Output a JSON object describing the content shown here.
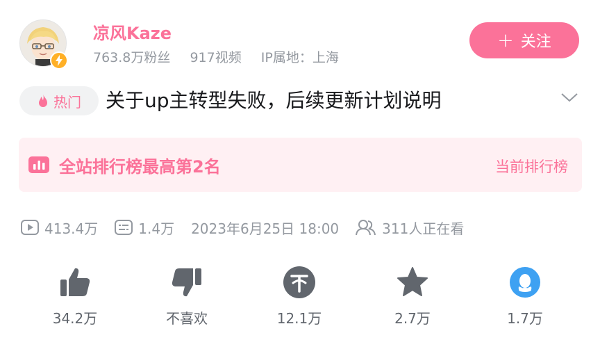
{
  "author": {
    "name": "凉风Kaze",
    "followers": "763.8万粉丝",
    "videos": "917视频",
    "ip_location": "IP属地：上海",
    "follow_label": "关注",
    "follow_plus": "+"
  },
  "video": {
    "tag": "热门",
    "title": "关于up主转型失败，后续更新计划说明"
  },
  "ranking": {
    "text": "全站排行榜最高第2名",
    "link": "当前排行榜"
  },
  "stats": {
    "plays": "413.4万",
    "danmaku": "1.4万",
    "date": "2023年6月25日 18:00",
    "watching": "311人正在看"
  },
  "actions": [
    {
      "label": "34.2万",
      "icon": "thumbs-up-icon"
    },
    {
      "label": "不喜欢",
      "icon": "thumbs-down-icon"
    },
    {
      "label": "12.1万",
      "icon": "coin-icon"
    },
    {
      "label": "2.7万",
      "icon": "star-icon"
    },
    {
      "label": "1.7万",
      "icon": "qq-share-icon"
    }
  ],
  "colors": {
    "accent": "#fb7299",
    "muted": "#9499a0",
    "icon": "#61666d",
    "qq": "#3ea1f2"
  }
}
